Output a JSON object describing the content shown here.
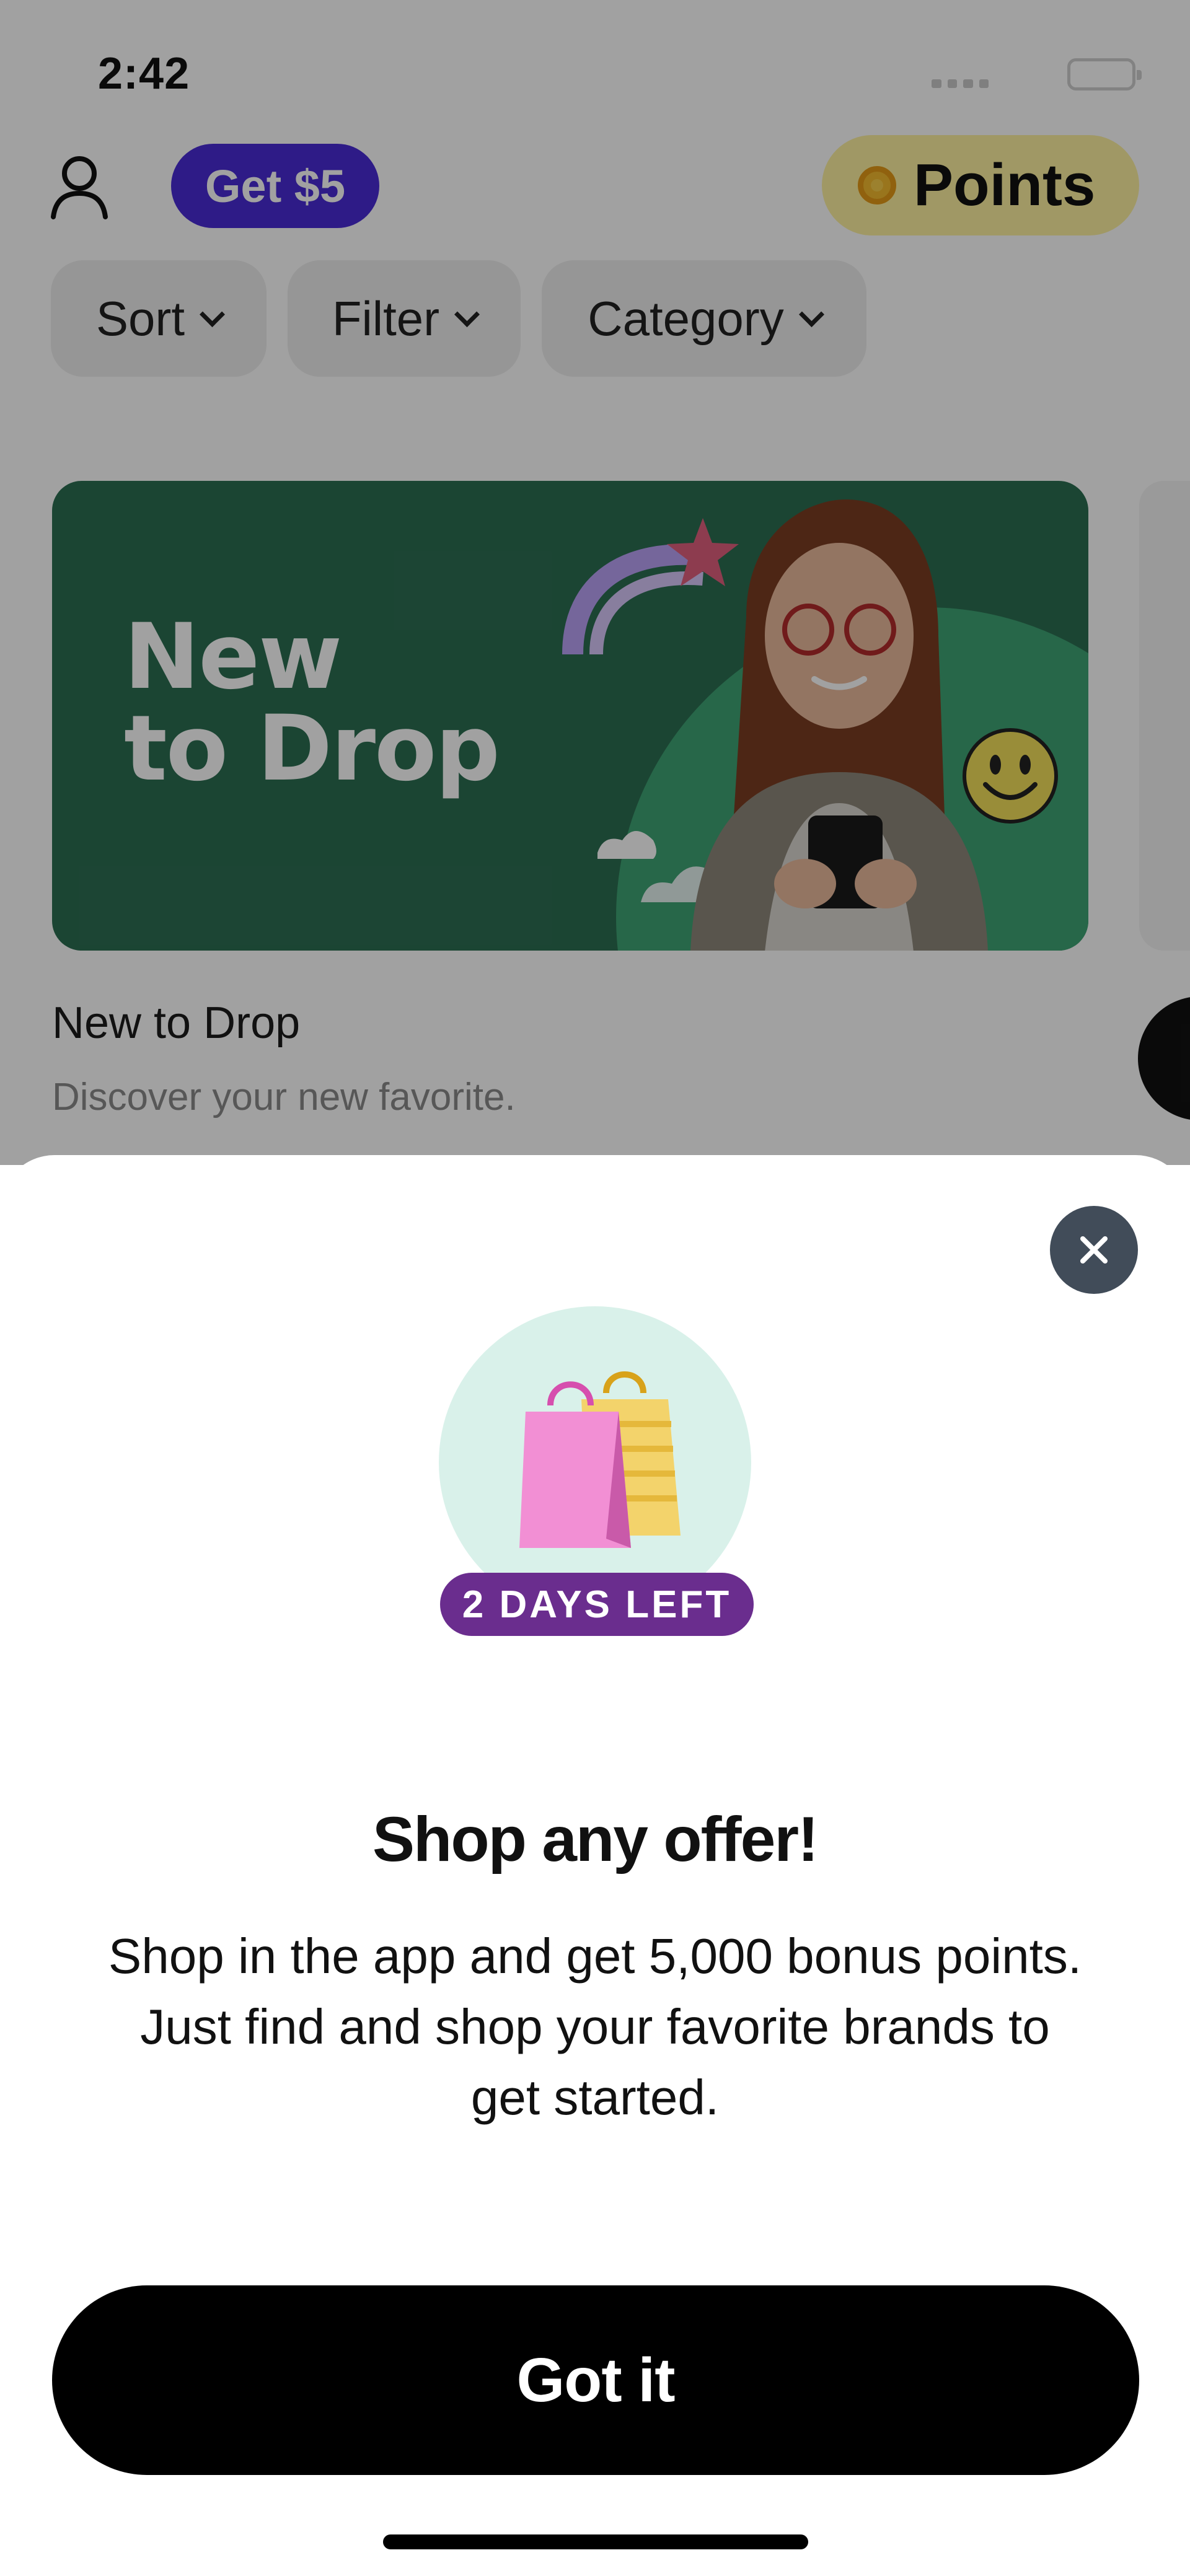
{
  "status_bar": {
    "time": "2:42"
  },
  "header": {
    "referral_label": "Get $5",
    "points_label": "Points"
  },
  "filters": {
    "sort": "Sort",
    "filter": "Filter",
    "category": "Category"
  },
  "banner": {
    "image_text": "New\nto Drop",
    "title": "New to Drop",
    "subtitle": "Discover your new favorite."
  },
  "modal": {
    "badge": "2 DAYS LEFT",
    "title": "Shop any offer!",
    "body": "Shop in the app and get 5,000 bonus points. Just find and shop your favorite brands to get started.",
    "cta": "Got it"
  },
  "colors": {
    "referral_bg": "#4a2bd6",
    "points_bg": "#fdf1a0",
    "banner_green": "#2c6e52",
    "badge_purple": "#6a2d8e",
    "close_button": "#414c59",
    "cta_bg": "#000000"
  },
  "icons": [
    "profile-icon",
    "chevron-down-icon",
    "close-icon",
    "shopping-bags-icon",
    "points-coin-icon",
    "wifi-icon",
    "battery-icon"
  ]
}
